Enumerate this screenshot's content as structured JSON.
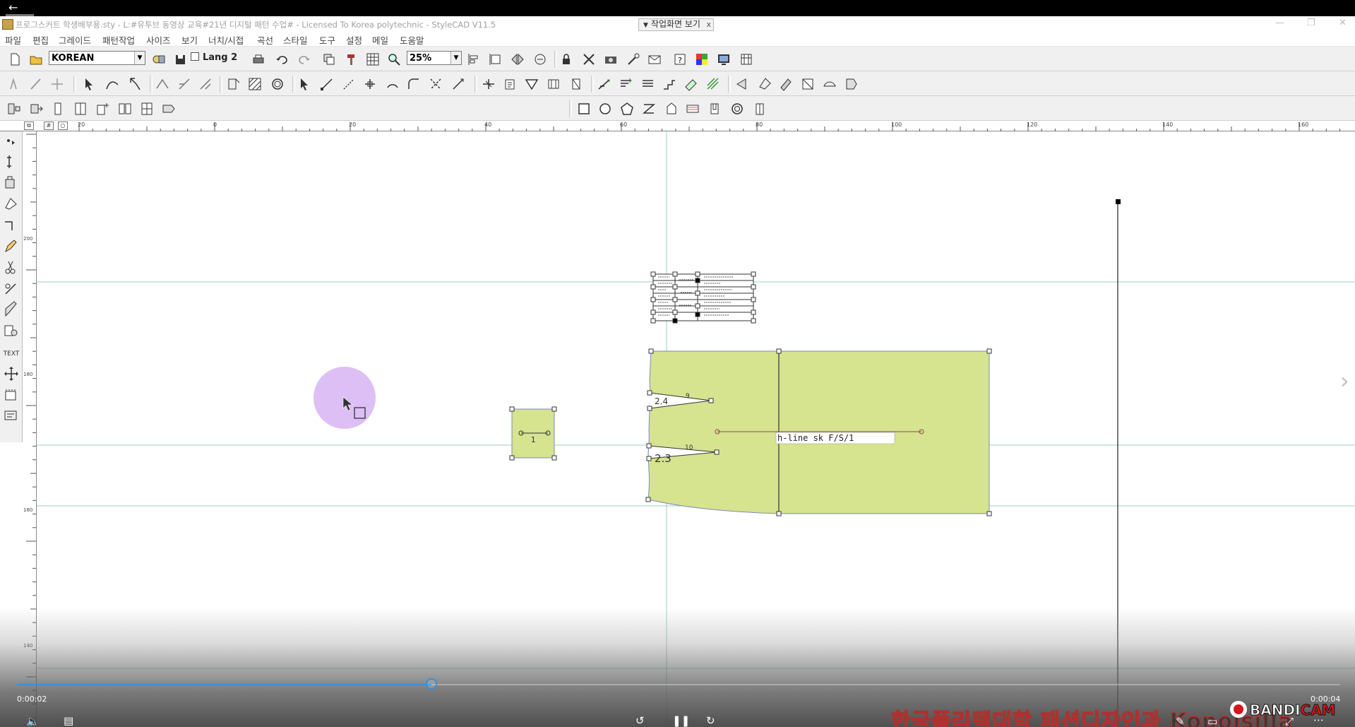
{
  "window": {
    "title": "프로그스커트 학생배부용.sty - L:#유투브 동영상 교육#21년 디지털 패턴 수업# - Licensed To Korea polytechnic - StyleCAD V11.5",
    "view_toggle_label": "작업화면 보기",
    "view_toggle_close": "x",
    "back_glyph": "←"
  },
  "menu": [
    "파일",
    "편집",
    "그레이드",
    "패턴작업",
    "사이즈",
    "보기",
    "너치/시접",
    "곡선",
    "스타일",
    "도구",
    "설정",
    "메일",
    "도움말"
  ],
  "toolbar": {
    "language_combo": "KOREAN",
    "lang2_label": "Lang 2",
    "zoom_combo": "25%"
  },
  "ruler": {
    "top_labels": [
      "20",
      "0",
      "20",
      "40",
      "60",
      "80",
      "100",
      "120",
      "140",
      "160"
    ],
    "left_labels": [
      "200",
      "180",
      "160",
      "140"
    ]
  },
  "canvas": {
    "small_piece_label": "1",
    "main_piece_label": "h-line sk F/S/1",
    "dart_upper_label": "2.4",
    "dart_upper_mark": "9",
    "dart_lower_label": "2.3",
    "dart_lower_mark": "10"
  },
  "video": {
    "time_current": "0:00:02",
    "time_total": "0:00:04",
    "progress": 0.313,
    "subtitle": "한국폴리텍대학 패션디자인과 Kopolsilla",
    "recorder_prefix": "BANDI",
    "recorder_suffix": "CAM"
  },
  "colors": {
    "piece_fill": "#d6e38f",
    "guide_line": "#9ccfc4",
    "progress_accent": "#3b8ed6",
    "cursor_highlight": "#d9b8f5"
  }
}
